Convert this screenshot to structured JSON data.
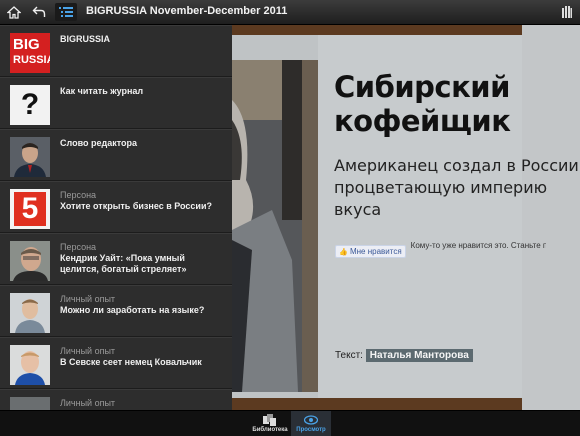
{
  "topbar": {
    "title": "BIGRUSSIA November-December 2011",
    "icons": [
      "home-icon",
      "back-icon",
      "list-icon",
      "signal-icon"
    ]
  },
  "toc": [
    {
      "category": "",
      "title": "BIGRUSSIA",
      "thumb": "big-russia-logo"
    },
    {
      "category": "",
      "title": "Как читать журнал",
      "thumb": "question-mark"
    },
    {
      "category": "",
      "title": "Слово редактора",
      "thumb": "editor-portrait"
    },
    {
      "category": "Персона",
      "title": "Хотите открыть бизнес в России?",
      "thumb": "channel-5-logo"
    },
    {
      "category": "Персона",
      "title": "Кендрик Уайт: «Пока умный целится, богатый стреляет»",
      "thumb": "portrait"
    },
    {
      "category": "Личный опыт",
      "title": "Можно ли заработать на языке?",
      "thumb": "portrait"
    },
    {
      "category": "Личный опыт",
      "title": "В Севске сеет немец Ковальчик",
      "thumb": "portrait"
    },
    {
      "category": "Личный опыт",
      "title": "",
      "thumb": "portrait"
    }
  ],
  "logo": {
    "line1": "BIG",
    "line2": "RUSSIA"
  },
  "article": {
    "headline_line1": "Сибирский",
    "headline_line2": "кофейщик",
    "subhead": "Американец создал в России процветающую империю вкуса",
    "like_button": "Мне нравится",
    "like_text": "Кому-то уже нравится это. Станьте первым из своих друзей",
    "author_label": "Текст:",
    "author_name": "Наталья Манторова"
  },
  "bottombar": {
    "items": [
      {
        "label": "Библиотека",
        "icon": "library-icon",
        "active": false
      },
      {
        "label": "Просмотр",
        "icon": "eye-icon",
        "active": true
      }
    ]
  },
  "colors": {
    "accent": "#4aa3e8",
    "logo_red": "#d42020",
    "band_brown": "#5c3a20",
    "page_bg": "#c7cbcd"
  }
}
